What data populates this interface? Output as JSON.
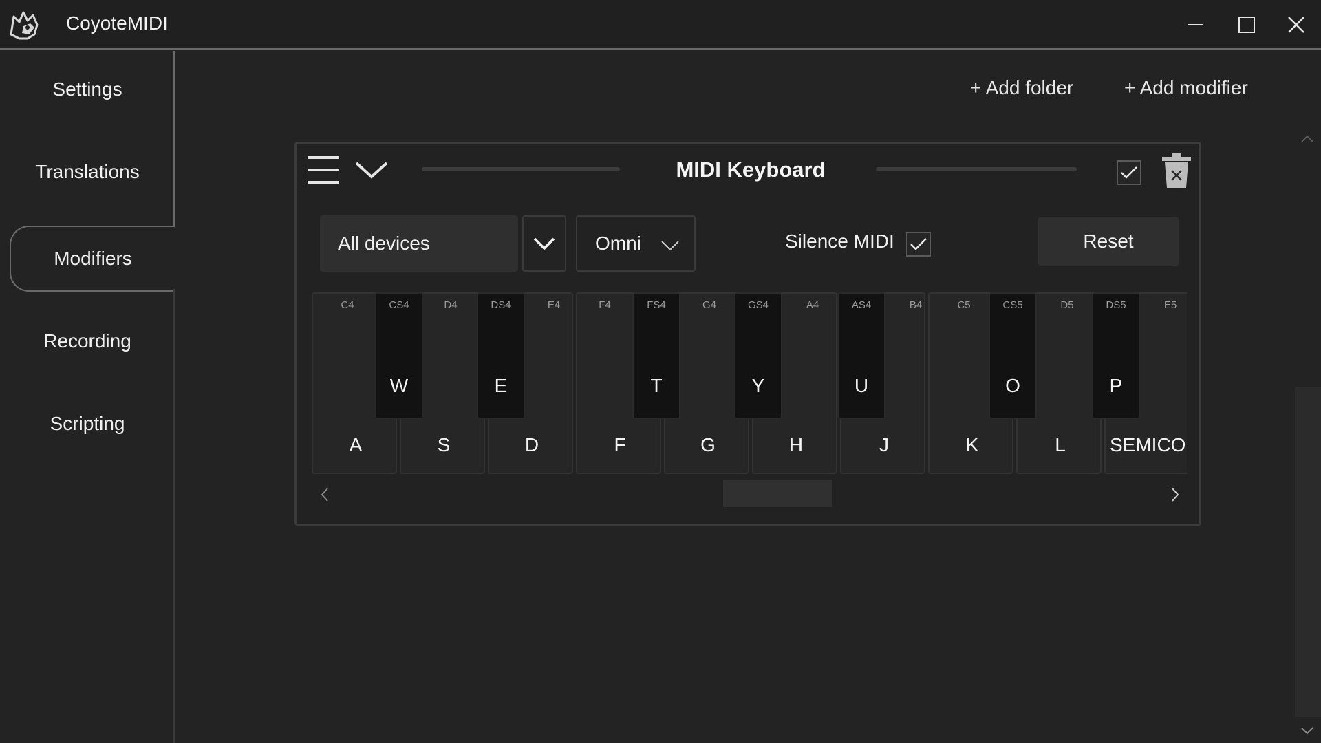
{
  "app": {
    "title": "CoyoteMIDI"
  },
  "sidebar": {
    "items": [
      {
        "label": "Settings",
        "active": false
      },
      {
        "label": "Translations",
        "active": false
      },
      {
        "label": "Modifiers",
        "active": true
      },
      {
        "label": "Recording",
        "active": false
      },
      {
        "label": "Scripting",
        "active": false
      }
    ]
  },
  "actions": {
    "add_folder": "+ Add folder",
    "add_modifier": "+ Add modifier"
  },
  "modifier": {
    "title": "MIDI Keyboard",
    "enabled": true,
    "device": "All devices",
    "channel": "Omni",
    "silence_label": "Silence MIDI",
    "silence_checked": true,
    "reset_label": "Reset"
  },
  "keyboard": {
    "white_keys": [
      {
        "note": "C4",
        "key": "A"
      },
      {
        "note": "D4",
        "key": "S"
      },
      {
        "note": "E4",
        "key": "D"
      },
      {
        "note": "F4",
        "key": "F"
      },
      {
        "note": "G4",
        "key": "G"
      },
      {
        "note": "A4",
        "key": "H"
      },
      {
        "note": "B4",
        "key": "J"
      },
      {
        "note": "C5",
        "key": "K"
      },
      {
        "note": "D5",
        "key": "L"
      },
      {
        "note": "E5",
        "key": "SEMICOLON"
      }
    ],
    "black_keys": [
      {
        "note": "CS4",
        "key": "W"
      },
      {
        "note": "DS4",
        "key": "E"
      },
      {
        "note": "FS4",
        "key": "T"
      },
      {
        "note": "GS4",
        "key": "Y"
      },
      {
        "note": "AS4",
        "key": "U"
      },
      {
        "note": "CS5",
        "key": "O"
      },
      {
        "note": "DS5",
        "key": "P"
      }
    ]
  },
  "colors": {
    "background": "#232323",
    "panel_border": "#3c3c3c",
    "black_key": "#121212",
    "white_key": "#262626"
  },
  "icons": [
    "coyote-logo-icon",
    "minimize-icon",
    "maximize-icon",
    "close-icon",
    "hamburger-icon",
    "chevron-down-icon",
    "checkmark-icon",
    "trash-icon",
    "chevron-left-icon",
    "chevron-right-icon",
    "chevron-up-icon"
  ]
}
